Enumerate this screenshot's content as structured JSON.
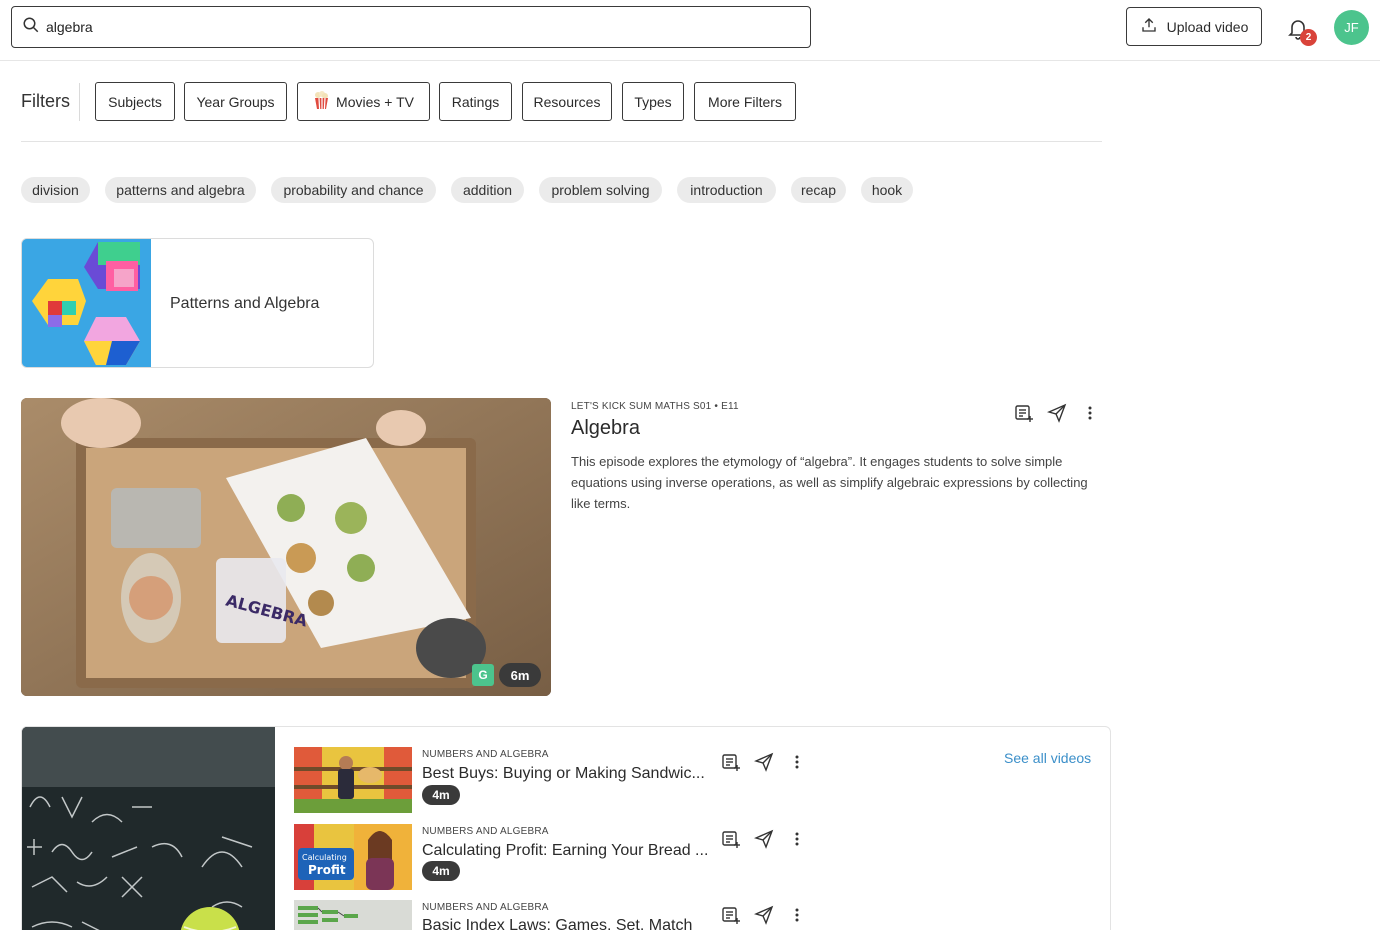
{
  "search": {
    "value": "algebra"
  },
  "header": {
    "upload_label": "Upload video",
    "notifications_count": "2",
    "avatar_initials": "JF"
  },
  "filters": {
    "label": "Filters",
    "buttons": [
      "Subjects",
      "Year Groups",
      "Movies + TV",
      "Ratings",
      "Resources",
      "Types",
      "More Filters"
    ]
  },
  "chips": [
    "division",
    "patterns and algebra",
    "probability and chance",
    "addition",
    "problem solving",
    "introduction",
    "recap",
    "hook"
  ],
  "subject_card": {
    "title": "Patterns and Algebra"
  },
  "featured": {
    "eyebrow": "LET'S KICK SUM MATHS S01 • E11",
    "title": "Algebra",
    "description": "This episode explores the etymology of “algebra”. It engages students to solve simple equations using inverse operations, as well as simplify algebraic expressions by collecting like terms.",
    "rating": "G",
    "duration": "6m",
    "thumb_text": "ALGEBRA"
  },
  "collection": {
    "see_all_label": "See all videos",
    "items": [
      {
        "category": "NUMBERS AND ALGEBRA",
        "title": "Best Buys: Buying or Making Sandwic...",
        "duration": "4m"
      },
      {
        "category": "NUMBERS AND ALGEBRA",
        "title": "Calculating Profit: Earning Your Bread ...",
        "duration": "4m",
        "thumb_text_1": "Calculating",
        "thumb_text_2": "Profit"
      },
      {
        "category": "NUMBERS AND ALGEBRA",
        "title": "Basic Index Laws: Games, Set, Match",
        "duration": ""
      }
    ]
  },
  "colors": {
    "accent_green": "#4cc48d",
    "badge_red": "#d9433a",
    "link_blue": "#3b8fc9"
  },
  "icons": [
    "search-icon",
    "upload-icon",
    "bell-icon",
    "popcorn-icon",
    "add-to-playlist-icon",
    "share-icon",
    "more-options-icon"
  ]
}
